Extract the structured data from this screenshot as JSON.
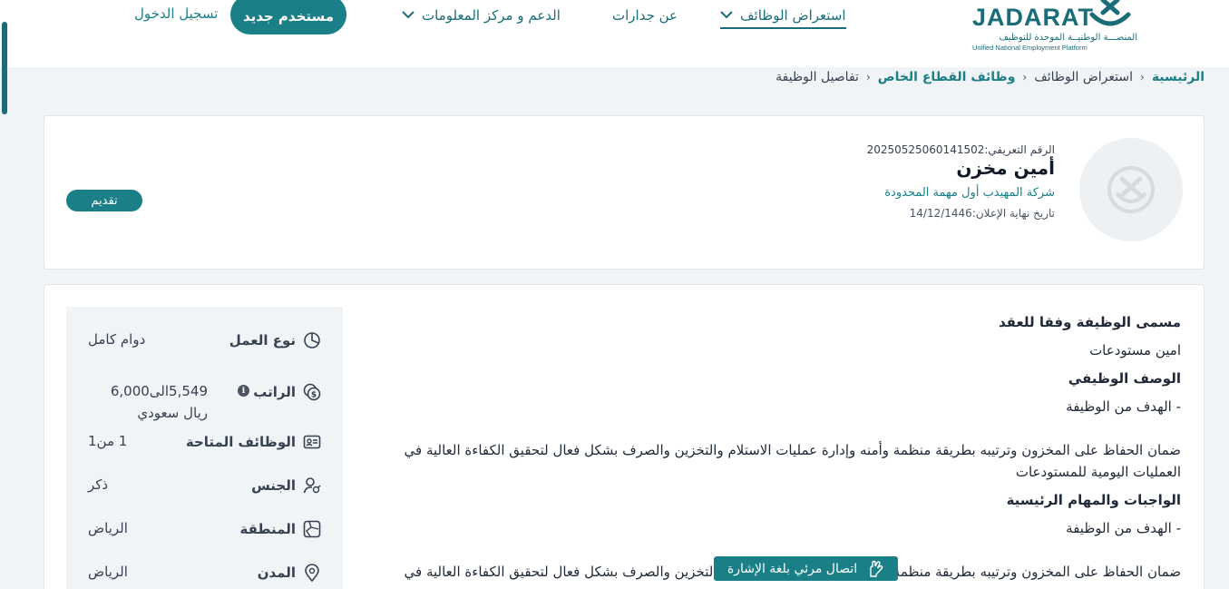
{
  "header": {
    "logo": {
      "wordmark": "JADARAT",
      "arabic_name": "المنصـــة الوطنيــة الموحدة للتوظيف",
      "english_name": "Unified National Employment Platform"
    },
    "nav": [
      {
        "label": "استعراض الوظائف",
        "has_dropdown": true,
        "active": true
      },
      {
        "label": "عن جدارات",
        "has_dropdown": false,
        "active": false
      },
      {
        "label": "الدعم و مركز المعلومات",
        "has_dropdown": true,
        "active": false
      }
    ],
    "new_user_button": "مستخدم جديد",
    "login_link": "تسجيل الدخول"
  },
  "breadcrumb": {
    "home": "الرئيسية",
    "browse": "استعراض الوظائف",
    "sector": "وظائف القطاع الخاص",
    "current": "تفاصيل الوظيفة"
  },
  "job": {
    "ref_label": "الرقم التعريفي:",
    "ref_value": "20250525060141502",
    "title": "أمين مخزن",
    "company": "شركة المهيدب أول مهمة المحدودة",
    "deadline_label": "تاريخ نهاية الإعلان:",
    "deadline_value": "14/12/1446",
    "apply_button": "تقديم"
  },
  "details": {
    "info": [
      {
        "label": "نوع العمل",
        "value": "دوام كامل",
        "icon": "pie-chart-icon"
      },
      {
        "label": "الراتب",
        "value": "5,549الى6,000 ريال سعودي",
        "icon": "money-icon"
      },
      {
        "label": "الوظائف المتاحة",
        "value": "1 من1",
        "icon": "id-card-icon"
      },
      {
        "label": "الجنس",
        "value": "ذكر",
        "icon": "user-gender-icon"
      },
      {
        "label": "المنطقة",
        "value": "الرياض",
        "icon": "region-map-icon"
      },
      {
        "label": "المدن",
        "value": "الرياض",
        "icon": "location-pin-icon"
      }
    ],
    "contract_title_heading": "مسمى الوظيفة وفقا للعقد",
    "contract_title_value": "امين مستودعات",
    "job_desc_heading": "الوصف الوظيفي",
    "job_desc_lead": "- الهدف من الوظيفة",
    "job_desc_body": "ضمان الحفاظ على المخزون وترتيبه بطريقة منظمة وأمنه وإدارة عمليات الاستلام والتخزين والصرف بشكل فعال لتحقيق الكفاءة العالية في العمليات اليومية للمستودعات",
    "duties_heading": "الواجبات والمهام الرئيسية",
    "duties_lead": "- الهدف من الوظيفة",
    "duties_body": "ضمان الحفاظ على المخزون وترتيبه بطريقة منظمة وأمنه وإدارة عمليات الاستلام والتخزين والصرف بشكل فعال لتحقيق الكفاءة العالية في"
  },
  "sign_language_button": "اتصال مرئي بلغة الإشارة",
  "colors": {
    "primary": "#1a7f86",
    "primary_dark": "#1a6d78",
    "page_bg": "#f1f4f6"
  }
}
